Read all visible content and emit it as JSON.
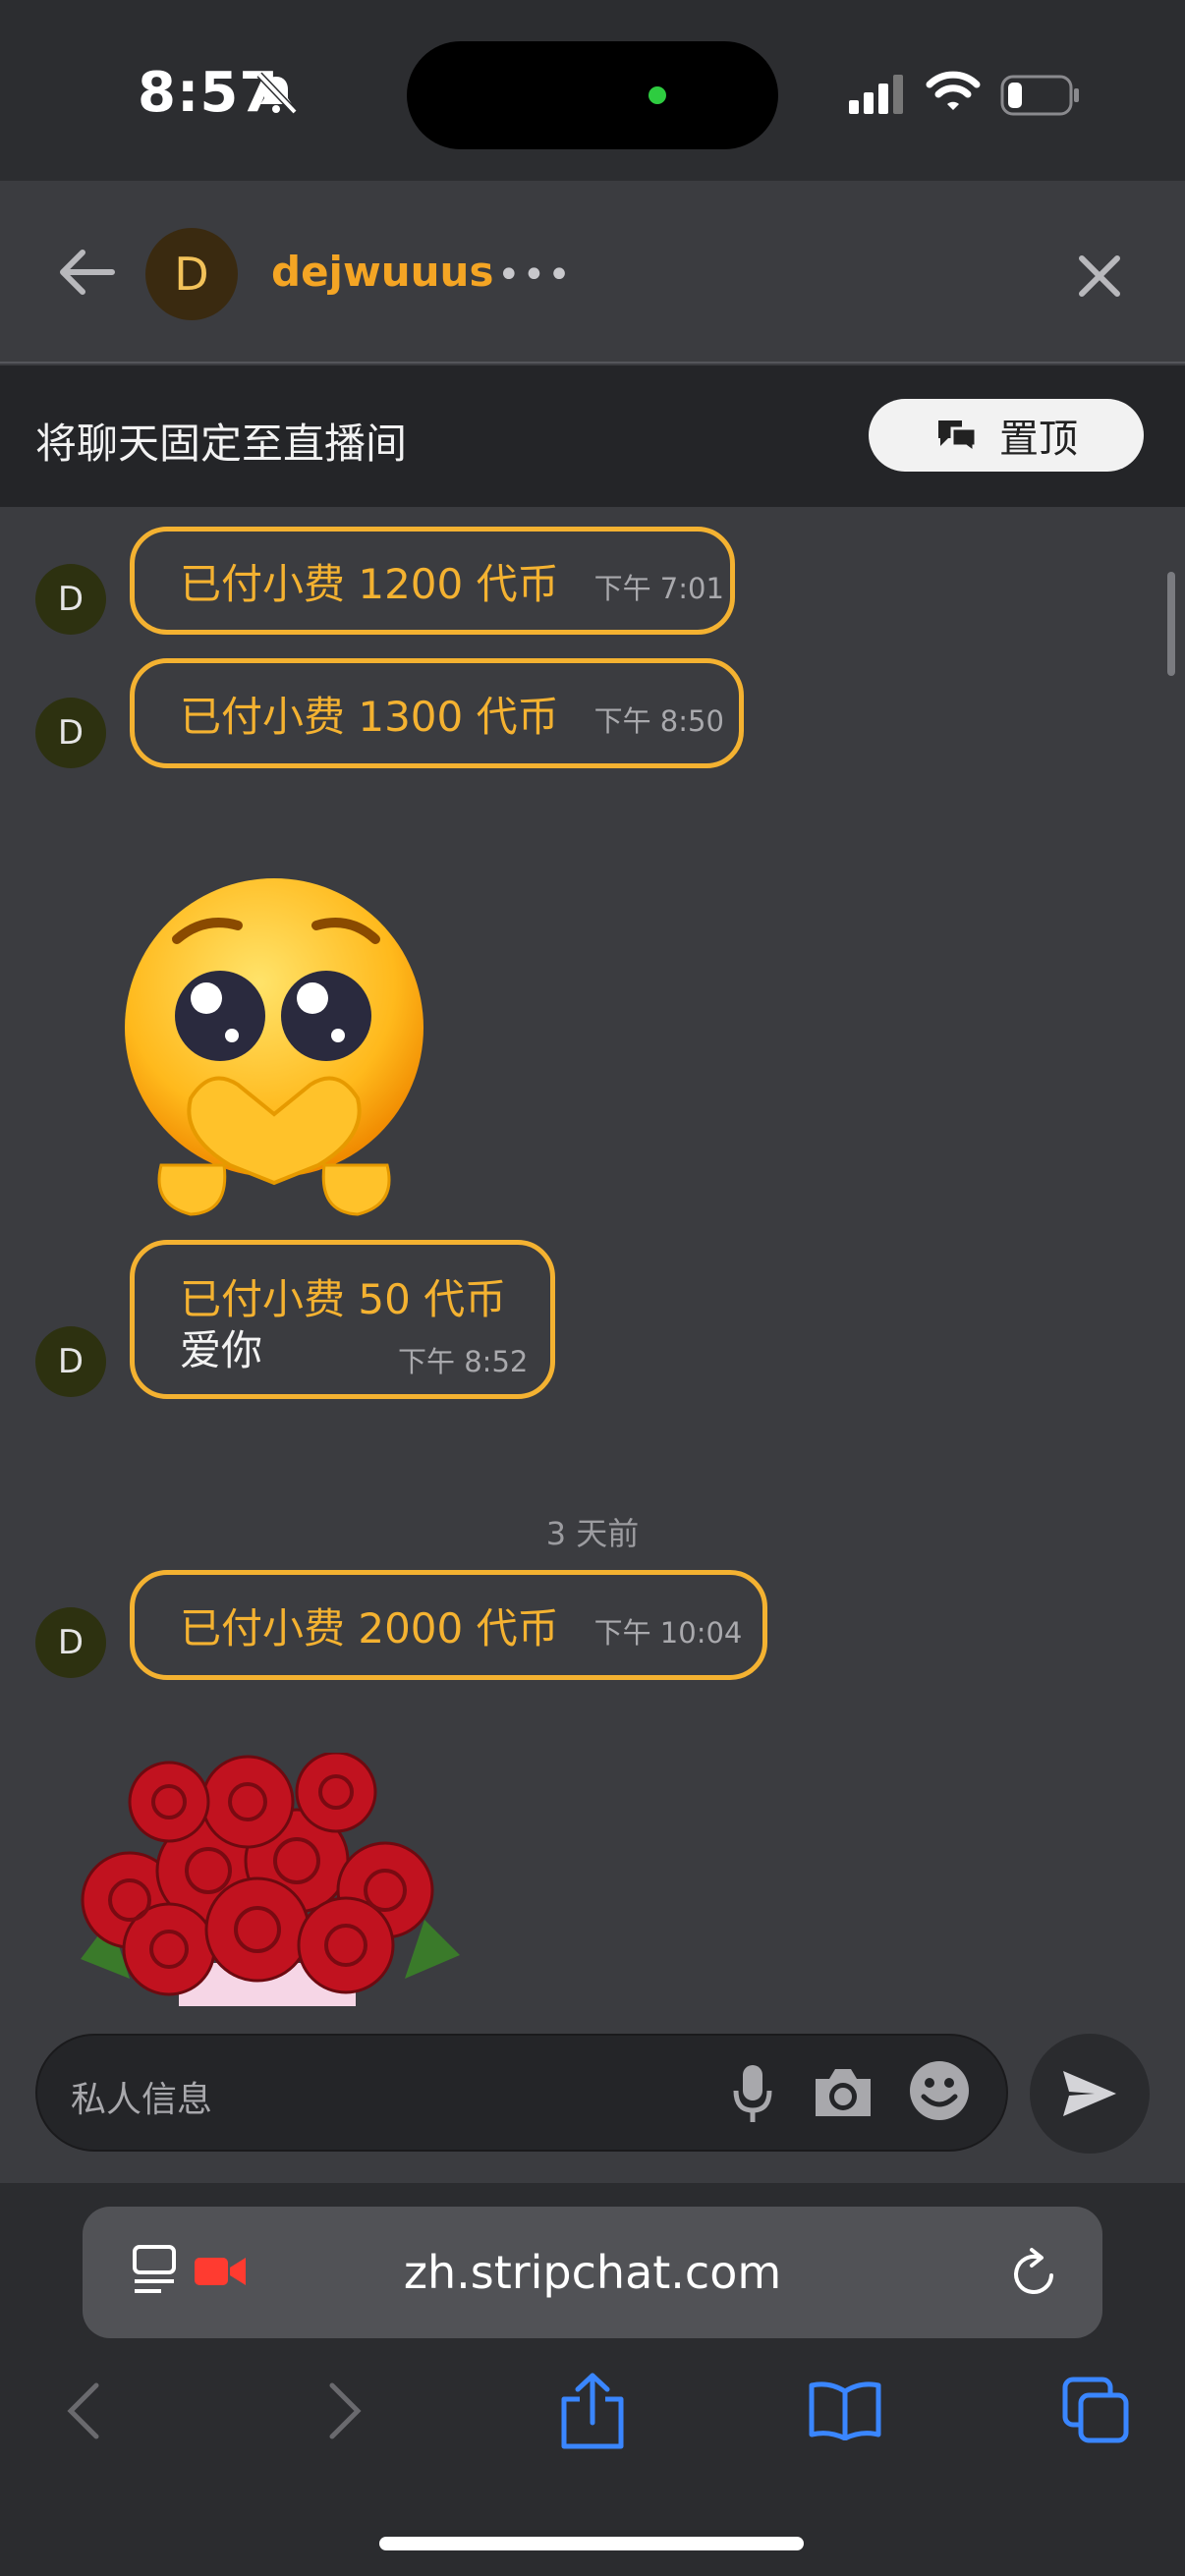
{
  "status_bar": {
    "time": "8:57"
  },
  "chat": {
    "avatar_initial": "D",
    "username": "dejwuuus",
    "more": "•••"
  },
  "pin_bar": {
    "text": "将聊天固定至直播间",
    "button": "置顶"
  },
  "messages": [
    {
      "avatar": "D",
      "text": "已付小费 1200 代币",
      "time": "下午 7:01"
    },
    {
      "avatar": "D",
      "text": "已付小费 1300 代币",
      "time": "下午 8:50"
    },
    {
      "avatar": "D",
      "text": "已付小费 50 代币",
      "note": "爱你",
      "time": "下午 8:52"
    },
    {
      "avatar": "D",
      "text": "已付小费 2000 代币",
      "time": "下午 10:04"
    }
  ],
  "day_separator": "3 天前",
  "input": {
    "placeholder": "私人信息"
  },
  "browser": {
    "url": "zh.stripchat.com"
  },
  "colors": {
    "accent": "#f4b231",
    "username": "#f4a524",
    "background": "#3b3c40"
  },
  "icons": [
    "back-arrow-icon",
    "close-icon",
    "chat-bubbles-icon",
    "microphone-icon",
    "camera-icon",
    "smiley-icon",
    "send-icon",
    "reader-icon",
    "video-icon",
    "reload-icon",
    "back-icon",
    "forward-icon",
    "share-icon",
    "bookmarks-icon",
    "tabs-icon"
  ]
}
